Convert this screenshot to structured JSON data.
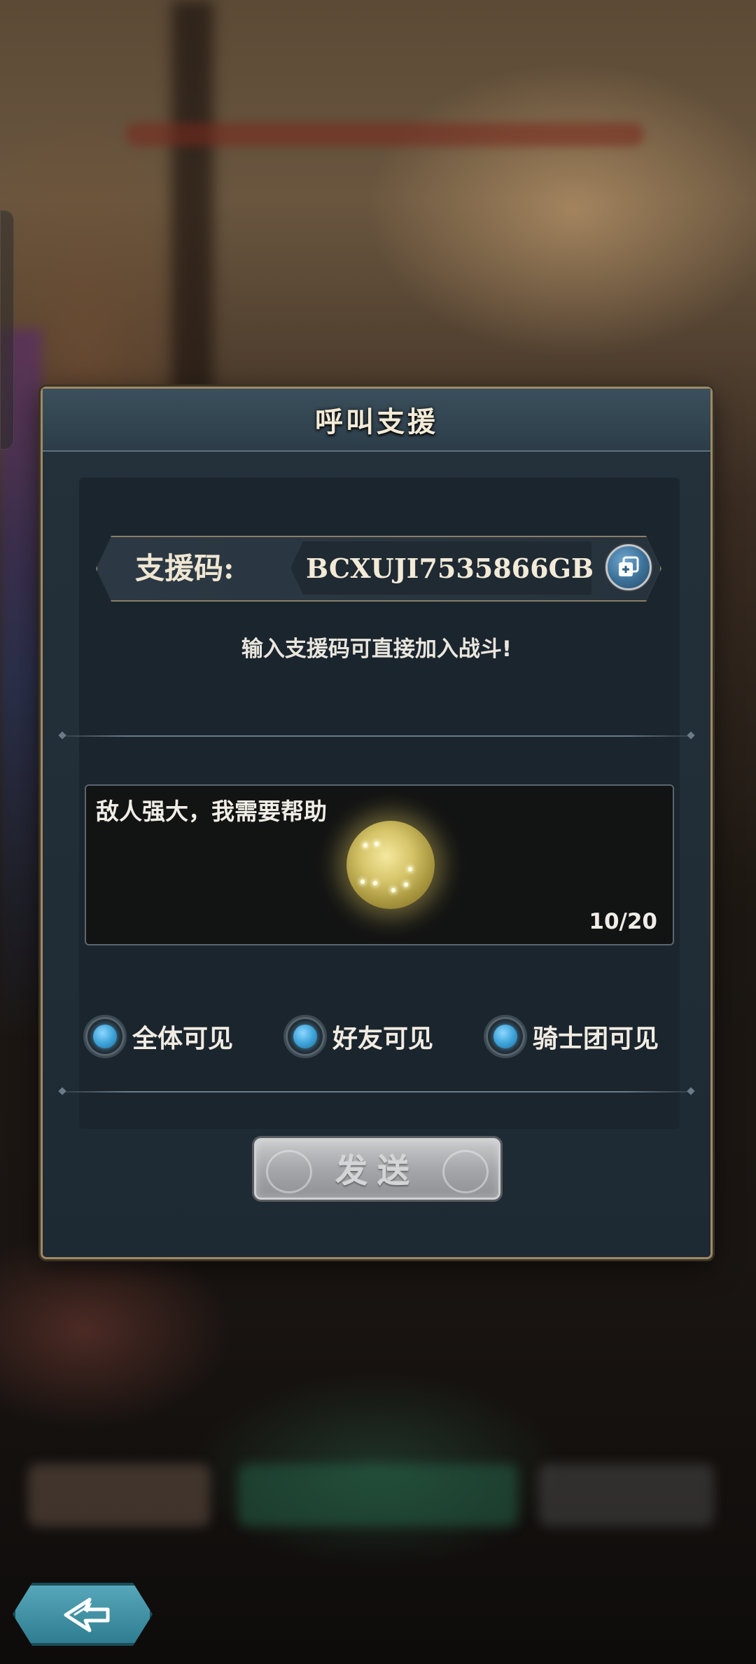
{
  "dialog": {
    "title": "呼叫支援",
    "support_code_label": "支援码:",
    "support_code_value": "BCXUJI7535866GB",
    "hint": "输入支援码可直接加入战斗!",
    "message": {
      "text": "敌人强大，我需要帮助",
      "counter": "10/20"
    },
    "visibility_options": [
      {
        "label": "全体可见"
      },
      {
        "label": "好友可见"
      },
      {
        "label": "骑士团可见"
      }
    ],
    "send_label": "发送"
  },
  "icons": {
    "copy": "copy-icon",
    "back": "back-arrow-icon"
  },
  "colors": {
    "frame_gold": "#a08a63",
    "panel": "#1b252d",
    "radio_blue": "#3fa5da",
    "button_silver": "#a5a7aa",
    "back_teal": "#3f8fa2"
  }
}
